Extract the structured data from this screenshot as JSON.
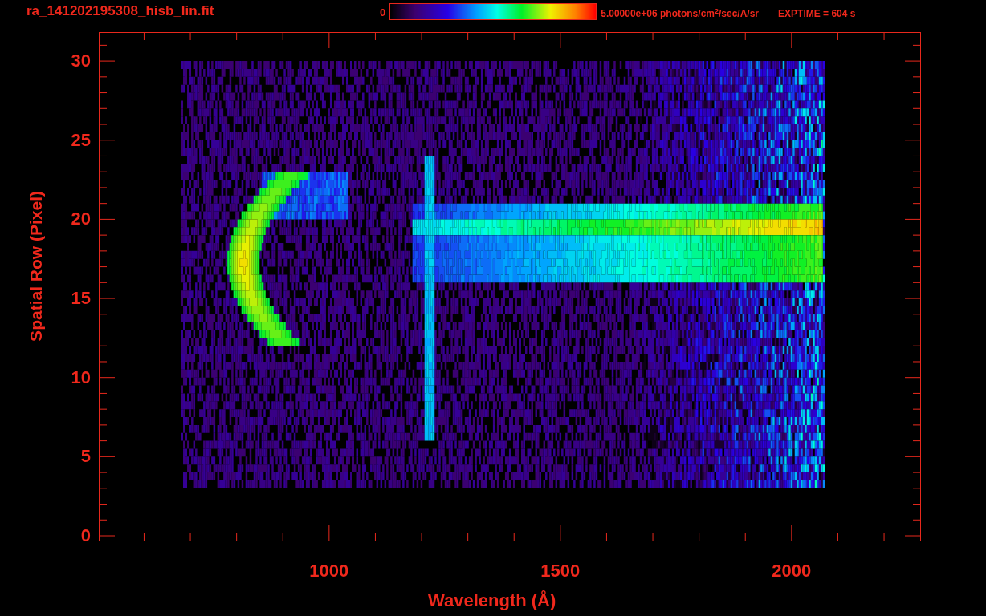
{
  "title": "ra_141202195308_hisb_lin.fit",
  "colorbar": {
    "min_label": "0",
    "max_label": "5.00000e+06 photons/cm$^{2}$/sec/A/sr"
  },
  "exposure": "EXPTIME = 604 s",
  "plot": {
    "xlabel": "Wavelength (Å)",
    "ylabel": "Spatial Row (Pixel)",
    "xticks": [
      "1000",
      "1500",
      "2000"
    ],
    "yticks": [
      "30",
      "25",
      "20",
      "15",
      "10",
      "5",
      "0"
    ]
  }
}
